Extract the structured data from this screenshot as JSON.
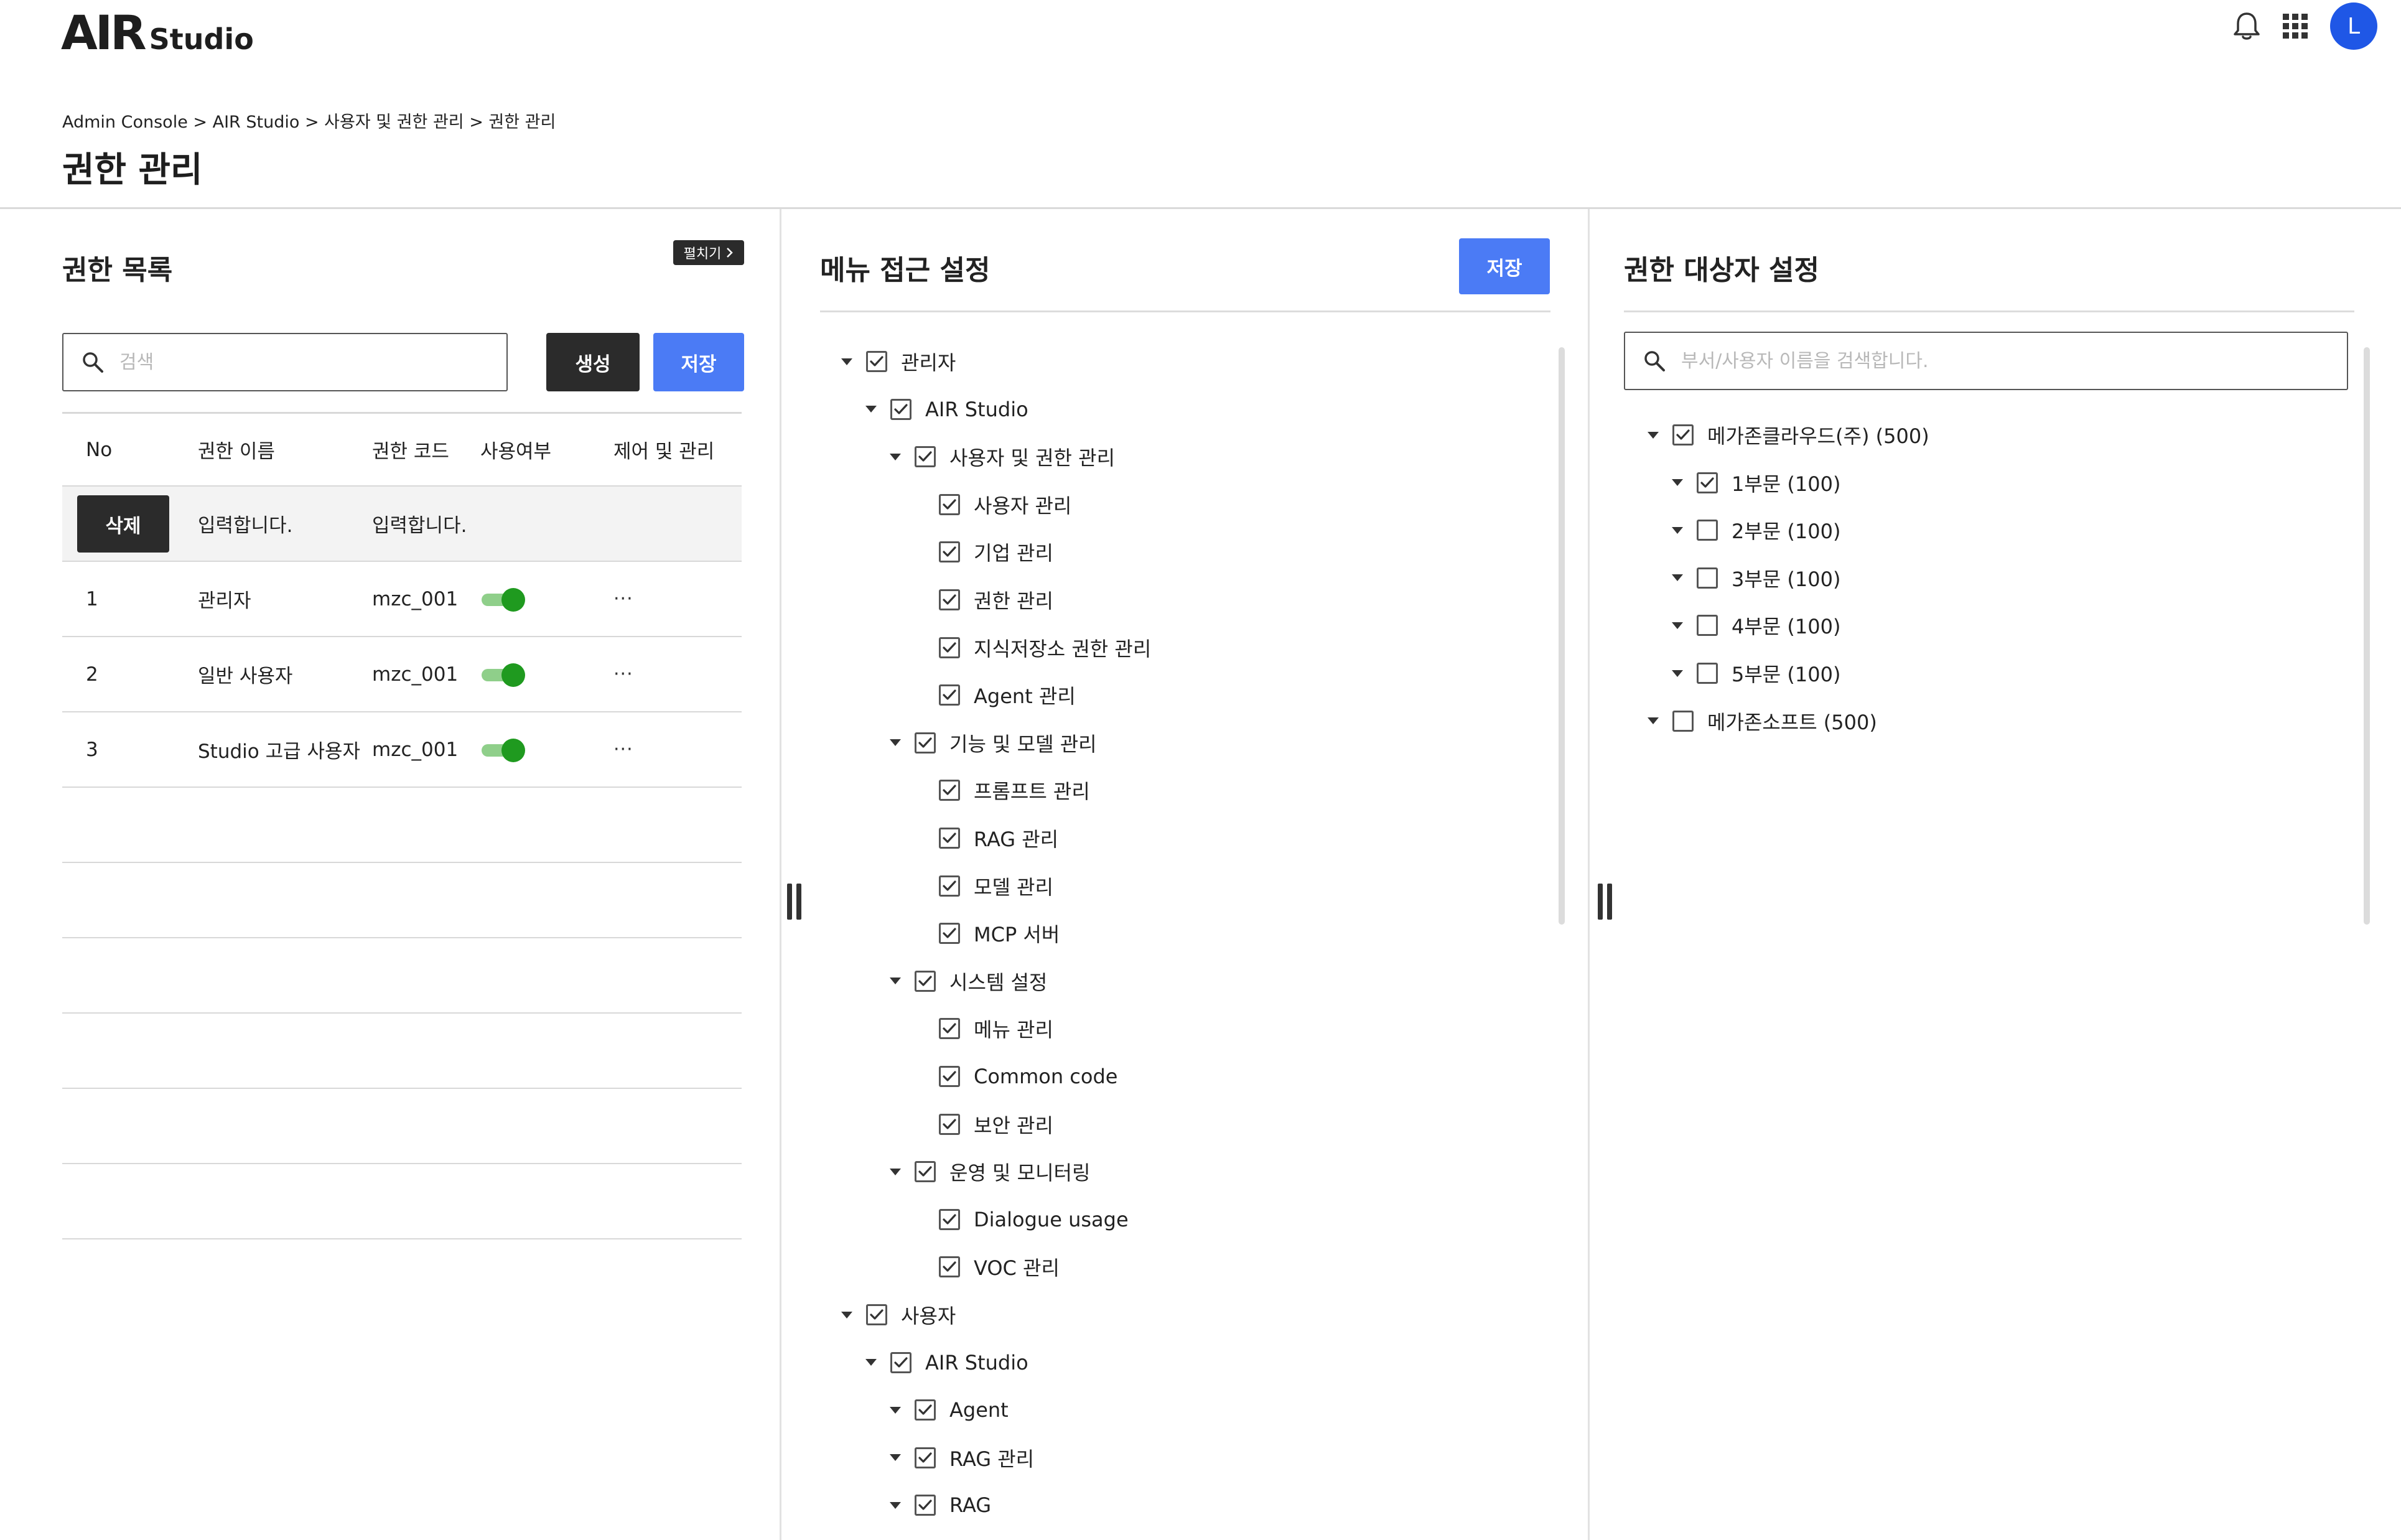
{
  "header": {
    "logo_main": "AIR",
    "logo_sub": "Studio",
    "avatar_initial": "L",
    "icons": [
      "bell-icon",
      "apps-grid-icon"
    ]
  },
  "breadcrumb": "Admin Console > AIR Studio > 사용자 및 권한 관리 > 권한 관리",
  "page_title": "권한 관리",
  "left_panel": {
    "title": "권한 목록",
    "expand_label": "펼치기",
    "search_placeholder": "검색",
    "create_label": "생성",
    "save_label": "저장",
    "columns": [
      "No",
      "권한 이름",
      "권한 코드",
      "사용여부",
      "제어 및 관리"
    ],
    "input_row": {
      "delete_label": "삭제",
      "name_placeholder": "입력합니다.",
      "code_placeholder": "입력합니다."
    },
    "rows": [
      {
        "no": "1",
        "name": "관리자",
        "code": "mzc_001",
        "enabled": true,
        "more": "···"
      },
      {
        "no": "2",
        "name": "일반 사용자",
        "code": "mzc_001",
        "enabled": true,
        "more": "···"
      },
      {
        "no": "3",
        "name": "Studio 고급 사용자",
        "code": "mzc_001",
        "enabled": true,
        "more": "···"
      }
    ]
  },
  "middle_panel": {
    "title": "메뉴 접근 설정",
    "save_label": "저장",
    "tree": [
      {
        "level": 0,
        "caret": true,
        "checked": true,
        "label": "관리자"
      },
      {
        "level": 1,
        "caret": true,
        "checked": true,
        "label": "AIR Studio"
      },
      {
        "level": 2,
        "caret": true,
        "checked": true,
        "label": "사용자 및 권한 관리"
      },
      {
        "level": 3,
        "caret": false,
        "checked": true,
        "label": "사용자 관리"
      },
      {
        "level": 3,
        "caret": false,
        "checked": true,
        "label": "기업 관리"
      },
      {
        "level": 3,
        "caret": false,
        "checked": true,
        "label": "권한 관리"
      },
      {
        "level": 3,
        "caret": false,
        "checked": true,
        "label": "지식저장소 권한 관리"
      },
      {
        "level": 3,
        "caret": false,
        "checked": true,
        "label": "Agent 관리"
      },
      {
        "level": 2,
        "caret": true,
        "checked": true,
        "label": "기능 및 모델 관리"
      },
      {
        "level": 3,
        "caret": false,
        "checked": true,
        "label": "프롬프트 관리"
      },
      {
        "level": 3,
        "caret": false,
        "checked": true,
        "label": "RAG 관리"
      },
      {
        "level": 3,
        "caret": false,
        "checked": true,
        "label": "모델 관리"
      },
      {
        "level": 3,
        "caret": false,
        "checked": true,
        "label": "MCP 서버"
      },
      {
        "level": 2,
        "caret": true,
        "checked": true,
        "label": "시스템 설정"
      },
      {
        "level": 3,
        "caret": false,
        "checked": true,
        "label": "메뉴 관리"
      },
      {
        "level": 3,
        "caret": false,
        "checked": true,
        "label": "Common code"
      },
      {
        "level": 3,
        "caret": false,
        "checked": true,
        "label": "보안 관리"
      },
      {
        "level": 2,
        "caret": true,
        "checked": true,
        "label": "운영 및 모니터링"
      },
      {
        "level": 3,
        "caret": false,
        "checked": true,
        "label": "Dialogue usage"
      },
      {
        "level": 3,
        "caret": false,
        "checked": true,
        "label": "VOC 관리"
      },
      {
        "level": 0,
        "caret": true,
        "checked": true,
        "label": "사용자"
      },
      {
        "level": 1,
        "caret": true,
        "checked": true,
        "label": "AIR Studio"
      },
      {
        "level": 2,
        "caret": true,
        "checked": true,
        "label": "Agent"
      },
      {
        "level": 2,
        "caret": true,
        "checked": true,
        "label": "RAG 관리"
      },
      {
        "level": 2,
        "caret": true,
        "checked": true,
        "label": "RAG"
      }
    ]
  },
  "right_panel": {
    "title": "권한 대상자 설정",
    "search_placeholder": "부서/사용자 이름을 검색합니다.",
    "tree": [
      {
        "level": 0,
        "caret": true,
        "checked": true,
        "label": "메가존클라우드(주) (500)"
      },
      {
        "level": 1,
        "caret": true,
        "checked": true,
        "label": "1부문 (100)"
      },
      {
        "level": 1,
        "caret": true,
        "checked": false,
        "label": "2부문 (100)"
      },
      {
        "level": 1,
        "caret": true,
        "checked": false,
        "label": "3부문 (100)"
      },
      {
        "level": 1,
        "caret": true,
        "checked": false,
        "label": "4부문 (100)"
      },
      {
        "level": 1,
        "caret": true,
        "checked": false,
        "label": "5부문 (100)"
      },
      {
        "level": 0,
        "caret": true,
        "checked": false,
        "label": "메가존소프트 (500)"
      }
    ]
  }
}
